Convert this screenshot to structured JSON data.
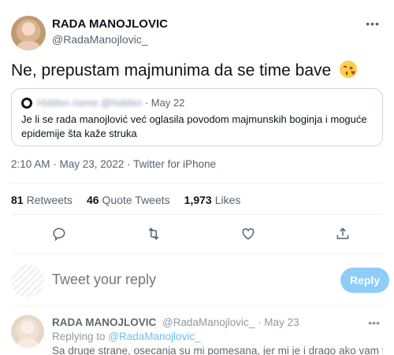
{
  "tweet": {
    "author_name": "RADA MANOJLOVIC",
    "author_handle": "@RadaManojlovic_",
    "text": "Ne, prepustam majmunima da se time bave",
    "emoji": "face-blowing-a-kiss",
    "quote": {
      "meta": "· May 22",
      "text": "Je li se rada manojlović već oglasila povodom majmunskih boginja i moguće epidemije šta kaže struka"
    },
    "time": "2:10 AM",
    "date": "May 23, 2022",
    "source": "Twitter for iPhone",
    "stats": {
      "retweets_count": "81",
      "retweets_label": "Retweets",
      "quotes_count": "46",
      "quotes_label": "Quote Tweets",
      "likes_count": "1,973",
      "likes_label": "Likes"
    }
  },
  "composer": {
    "placeholder": "Tweet your reply",
    "button_label": "Reply"
  },
  "reply": {
    "author_name": "RADA MANOJLOVIC",
    "author_handle": "@RadaManojlovic_",
    "date": "· May 23",
    "replying_prefix": "Replying to",
    "replying_handle": "@RadaManojlovic_",
    "text": "Sa druge strane, osecanja su mi pomesana, jer mi je i drago ako vam tolko"
  },
  "colors": {
    "accent": "#1d9bf0",
    "muted": "#536471",
    "button_disabled": "#8ecdf8"
  }
}
